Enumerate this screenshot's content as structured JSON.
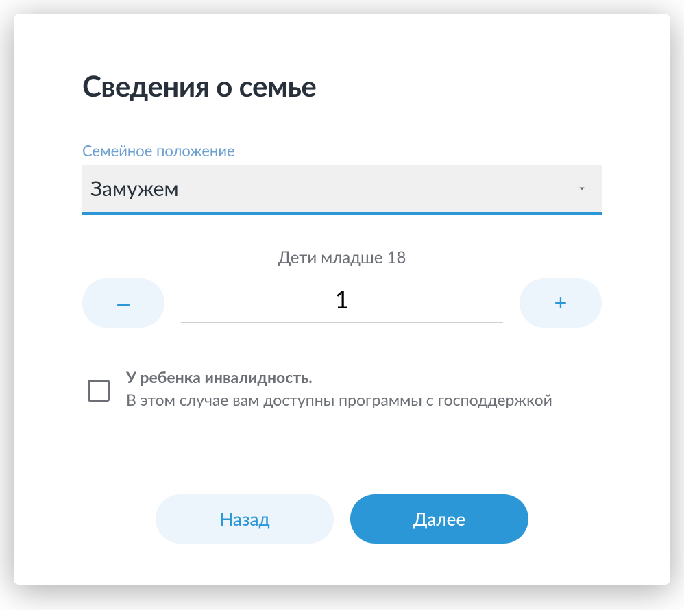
{
  "title": "Сведения о семье",
  "maritalStatus": {
    "label": "Семейное положение",
    "value": "Замужем"
  },
  "children": {
    "label": "Дети младше 18",
    "value": "1",
    "minusGlyph": "–",
    "plusGlyph": "+"
  },
  "disabilityCheckbox": {
    "line1": "У ребенка инвалидность.",
    "line2": "В этом случае вам доступны программы с господдержкой"
  },
  "actions": {
    "back": "Назад",
    "next": "Далее"
  }
}
